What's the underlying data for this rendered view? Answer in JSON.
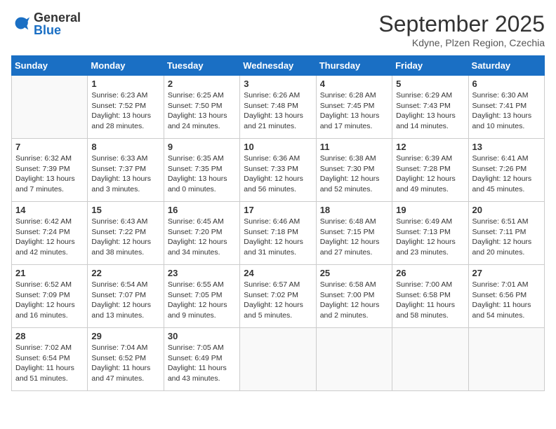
{
  "logo": {
    "general": "General",
    "blue": "Blue"
  },
  "header": {
    "month": "September 2025",
    "location": "Kdyne, Plzen Region, Czechia"
  },
  "weekdays": [
    "Sunday",
    "Monday",
    "Tuesday",
    "Wednesday",
    "Thursday",
    "Friday",
    "Saturday"
  ],
  "weeks": [
    [
      {
        "day": "",
        "info": ""
      },
      {
        "day": "1",
        "info": "Sunrise: 6:23 AM\nSunset: 7:52 PM\nDaylight: 13 hours\nand 28 minutes."
      },
      {
        "day": "2",
        "info": "Sunrise: 6:25 AM\nSunset: 7:50 PM\nDaylight: 13 hours\nand 24 minutes."
      },
      {
        "day": "3",
        "info": "Sunrise: 6:26 AM\nSunset: 7:48 PM\nDaylight: 13 hours\nand 21 minutes."
      },
      {
        "day": "4",
        "info": "Sunrise: 6:28 AM\nSunset: 7:45 PM\nDaylight: 13 hours\nand 17 minutes."
      },
      {
        "day": "5",
        "info": "Sunrise: 6:29 AM\nSunset: 7:43 PM\nDaylight: 13 hours\nand 14 minutes."
      },
      {
        "day": "6",
        "info": "Sunrise: 6:30 AM\nSunset: 7:41 PM\nDaylight: 13 hours\nand 10 minutes."
      }
    ],
    [
      {
        "day": "7",
        "info": "Sunrise: 6:32 AM\nSunset: 7:39 PM\nDaylight: 13 hours\nand 7 minutes."
      },
      {
        "day": "8",
        "info": "Sunrise: 6:33 AM\nSunset: 7:37 PM\nDaylight: 13 hours\nand 3 minutes."
      },
      {
        "day": "9",
        "info": "Sunrise: 6:35 AM\nSunset: 7:35 PM\nDaylight: 13 hours\nand 0 minutes."
      },
      {
        "day": "10",
        "info": "Sunrise: 6:36 AM\nSunset: 7:33 PM\nDaylight: 12 hours\nand 56 minutes."
      },
      {
        "day": "11",
        "info": "Sunrise: 6:38 AM\nSunset: 7:30 PM\nDaylight: 12 hours\nand 52 minutes."
      },
      {
        "day": "12",
        "info": "Sunrise: 6:39 AM\nSunset: 7:28 PM\nDaylight: 12 hours\nand 49 minutes."
      },
      {
        "day": "13",
        "info": "Sunrise: 6:41 AM\nSunset: 7:26 PM\nDaylight: 12 hours\nand 45 minutes."
      }
    ],
    [
      {
        "day": "14",
        "info": "Sunrise: 6:42 AM\nSunset: 7:24 PM\nDaylight: 12 hours\nand 42 minutes."
      },
      {
        "day": "15",
        "info": "Sunrise: 6:43 AM\nSunset: 7:22 PM\nDaylight: 12 hours\nand 38 minutes."
      },
      {
        "day": "16",
        "info": "Sunrise: 6:45 AM\nSunset: 7:20 PM\nDaylight: 12 hours\nand 34 minutes."
      },
      {
        "day": "17",
        "info": "Sunrise: 6:46 AM\nSunset: 7:18 PM\nDaylight: 12 hours\nand 31 minutes."
      },
      {
        "day": "18",
        "info": "Sunrise: 6:48 AM\nSunset: 7:15 PM\nDaylight: 12 hours\nand 27 minutes."
      },
      {
        "day": "19",
        "info": "Sunrise: 6:49 AM\nSunset: 7:13 PM\nDaylight: 12 hours\nand 23 minutes."
      },
      {
        "day": "20",
        "info": "Sunrise: 6:51 AM\nSunset: 7:11 PM\nDaylight: 12 hours\nand 20 minutes."
      }
    ],
    [
      {
        "day": "21",
        "info": "Sunrise: 6:52 AM\nSunset: 7:09 PM\nDaylight: 12 hours\nand 16 minutes."
      },
      {
        "day": "22",
        "info": "Sunrise: 6:54 AM\nSunset: 7:07 PM\nDaylight: 12 hours\nand 13 minutes."
      },
      {
        "day": "23",
        "info": "Sunrise: 6:55 AM\nSunset: 7:05 PM\nDaylight: 12 hours\nand 9 minutes."
      },
      {
        "day": "24",
        "info": "Sunrise: 6:57 AM\nSunset: 7:02 PM\nDaylight: 12 hours\nand 5 minutes."
      },
      {
        "day": "25",
        "info": "Sunrise: 6:58 AM\nSunset: 7:00 PM\nDaylight: 12 hours\nand 2 minutes."
      },
      {
        "day": "26",
        "info": "Sunrise: 7:00 AM\nSunset: 6:58 PM\nDaylight: 11 hours\nand 58 minutes."
      },
      {
        "day": "27",
        "info": "Sunrise: 7:01 AM\nSunset: 6:56 PM\nDaylight: 11 hours\nand 54 minutes."
      }
    ],
    [
      {
        "day": "28",
        "info": "Sunrise: 7:02 AM\nSunset: 6:54 PM\nDaylight: 11 hours\nand 51 minutes."
      },
      {
        "day": "29",
        "info": "Sunrise: 7:04 AM\nSunset: 6:52 PM\nDaylight: 11 hours\nand 47 minutes."
      },
      {
        "day": "30",
        "info": "Sunrise: 7:05 AM\nSunset: 6:49 PM\nDaylight: 11 hours\nand 43 minutes."
      },
      {
        "day": "",
        "info": ""
      },
      {
        "day": "",
        "info": ""
      },
      {
        "day": "",
        "info": ""
      },
      {
        "day": "",
        "info": ""
      }
    ]
  ]
}
